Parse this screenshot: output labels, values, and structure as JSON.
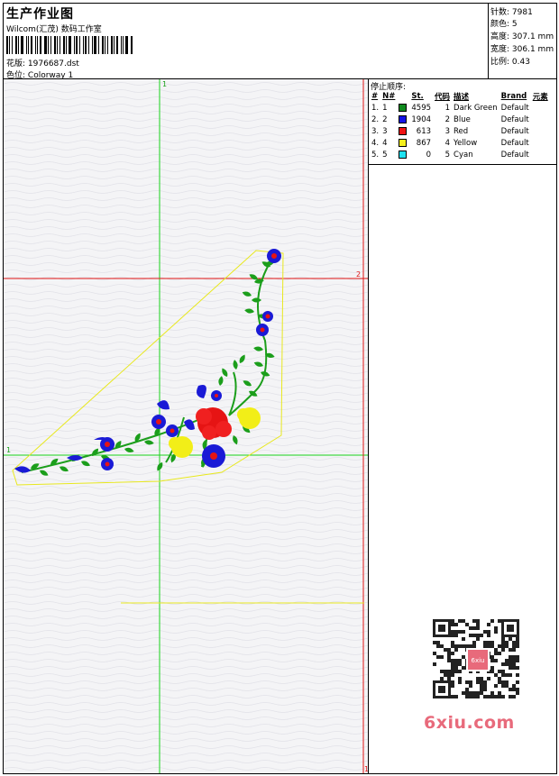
{
  "header": {
    "title": "生产作业图",
    "company": "Wilcom(汇茂) 数码工作室",
    "design_label": "花版:",
    "design_value": "1976687.dst",
    "colorway_label": "色位:",
    "colorway_value": "Colorway 1"
  },
  "info": {
    "stitches_label": "针数:",
    "stitches_value": "7981",
    "colors_label": "颜色:",
    "colors_value": "5",
    "height_label": "高度:",
    "height_value": "307.1 mm",
    "width_label": "宽度:",
    "width_value": "306.1 mm",
    "scale_label": "比例:",
    "scale_value": "0.43"
  },
  "stop_sequence": {
    "title": "停止顺序:",
    "columns": [
      "#",
      "N#",
      "St.",
      "代码",
      "描述",
      "Brand",
      "元素"
    ],
    "rows": [
      {
        "index": "1.",
        "n": "1",
        "color": "#0f8a1e",
        "stitches": "4595",
        "code": "1",
        "description": "Dark Green",
        "brand": "Default"
      },
      {
        "index": "2.",
        "n": "2",
        "color": "#1414e6",
        "stitches": "1904",
        "code": "2",
        "description": "Blue",
        "brand": "Default"
      },
      {
        "index": "3.",
        "n": "3",
        "color": "#f01414",
        "stitches": "613",
        "code": "3",
        "description": "Red",
        "brand": "Default"
      },
      {
        "index": "4.",
        "n": "4",
        "color": "#f5f01e",
        "stitches": "867",
        "code": "4",
        "description": "Yellow",
        "brand": "Default"
      },
      {
        "index": "5.",
        "n": "5",
        "color": "#1ee1f0",
        "stitches": "0",
        "code": "5",
        "description": "Cyan",
        "brand": "Default"
      }
    ]
  },
  "canvas": {
    "guide_labels": {
      "green_top": "1",
      "green_left": "1",
      "red_right": "2",
      "red_bottom": "1"
    },
    "colors": {
      "green_guide": "#19d219",
      "red_guide": "#e01414",
      "outline": "#e8e81e",
      "leaf": "#1b9e1b",
      "petal": "#1a1ad6",
      "center": "#e61414",
      "yellow": "#f2ee18"
    }
  },
  "watermark": {
    "site": "6xiu.com",
    "qr_stamp": "6xiu"
  }
}
